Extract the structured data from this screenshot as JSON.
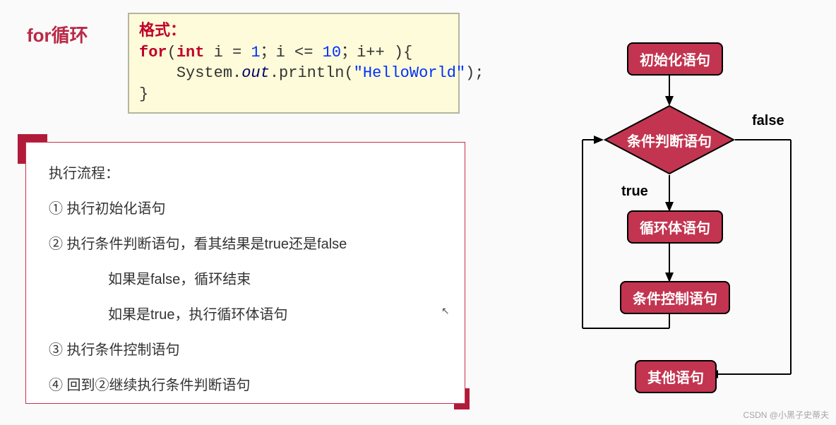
{
  "heading": "for循环",
  "code": {
    "label_format": "格式：",
    "kw_for": "for",
    "kw_int": "int",
    "var_i1": " i = ",
    "num_1": "1",
    "semi1": "；i <= ",
    "num_10": "10",
    "semi2": "；i++ ){",
    "indent_sp": "    ",
    "sys": "System.",
    "out": "out",
    "println": ".println(",
    "str": "\"HelloWorld\"",
    "close_paren": ");",
    "brace": "}"
  },
  "panel": {
    "title": "执行流程：",
    "s1": "① 执行初始化语句",
    "s2": "② 执行条件判断语句，看其结果是true还是false",
    "s2_false": "如果是false，循环结束",
    "s2_true": "如果是true，执行循环体语句",
    "s3": "③ 执行条件控制语句",
    "s4": "④ 回到②继续执行条件判断语句"
  },
  "flow": {
    "n1": "初始化语句",
    "n2": "条件判断语句",
    "n3": "循环体语句",
    "n4": "条件控制语句",
    "n5": "其他语句",
    "lbl_true": "true",
    "lbl_false": "false"
  },
  "watermark": "CSDN @小黑子史蒂夫"
}
